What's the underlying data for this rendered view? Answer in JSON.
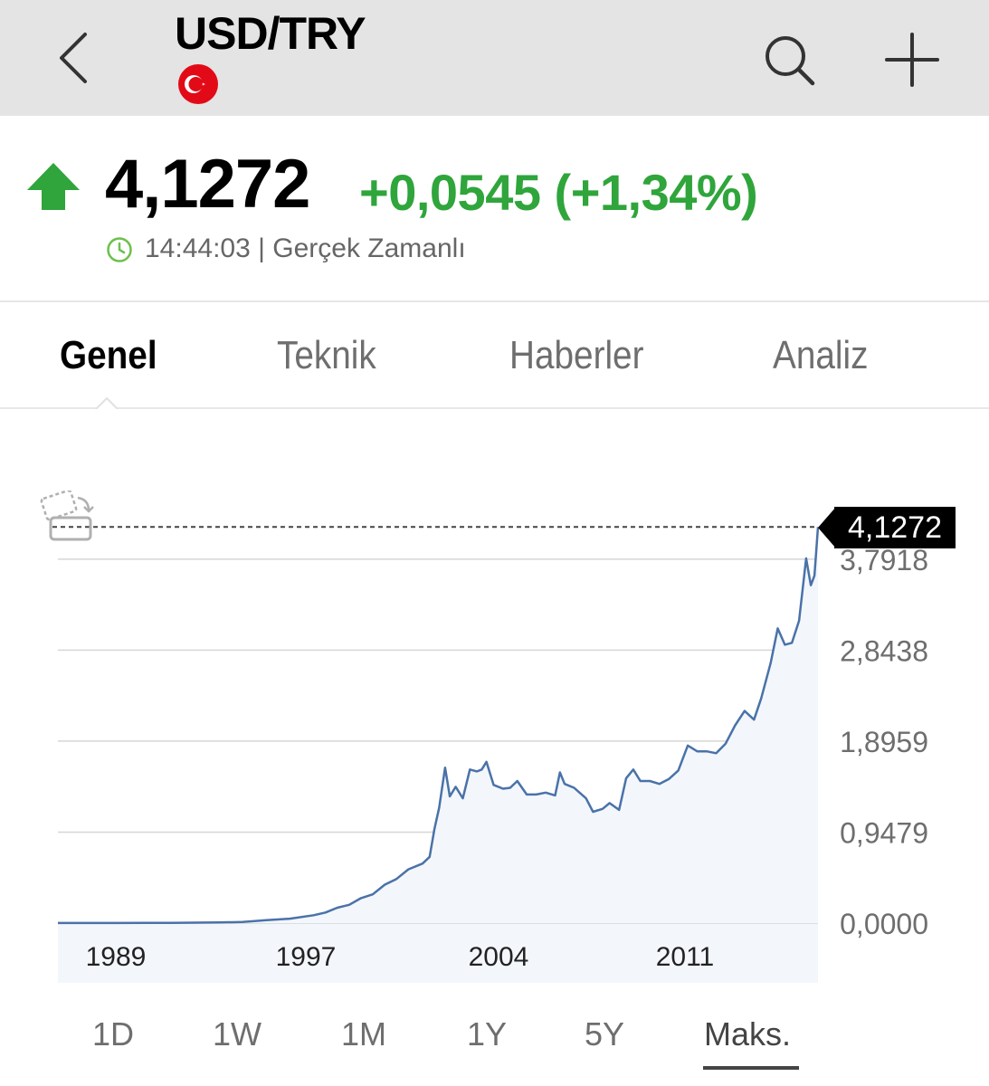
{
  "header": {
    "title": "USD/TRY",
    "flag_icon": "turkey-flag-icon",
    "back_icon": "chevron-left-icon",
    "search_icon": "search-icon",
    "add_icon": "plus-icon"
  },
  "quote": {
    "direction_icon": "arrow-up-icon",
    "price": "4,1272",
    "change": "+0,0545 (+1,34%)",
    "time": "14:44:03",
    "status": "| Gerçek Zamanlı",
    "change_color": "#2fa53b"
  },
  "tabs": [
    {
      "label": "Genel",
      "active": true
    },
    {
      "label": "Teknik",
      "active": false
    },
    {
      "label": "Haberler",
      "active": false
    },
    {
      "label": "Analiz",
      "active": false
    }
  ],
  "chart_data": {
    "type": "area",
    "current_value": 4.1272,
    "current_label": "4,1272",
    "y_ticks": [
      {
        "value": 0.0,
        "label": "0,0000"
      },
      {
        "value": 0.9479,
        "label": "0,9479"
      },
      {
        "value": 1.8959,
        "label": "1,8959"
      },
      {
        "value": 2.8438,
        "label": "2,8438"
      },
      {
        "value": 3.7918,
        "label": "3,7918"
      }
    ],
    "x_ticks": [
      "1989",
      "1997",
      "2004",
      "2011"
    ],
    "xlim": [
      1985.2,
      2017.3
    ],
    "ylim": [
      0.0,
      4.13
    ],
    "line_color": "#4a72a8",
    "fill_color": "#f3f7fc",
    "points": [
      [
        1985.2,
        0.0005
      ],
      [
        1987.0,
        0.0009
      ],
      [
        1989.0,
        0.0021
      ],
      [
        1990.0,
        0.0029
      ],
      [
        1991.0,
        0.0044
      ],
      [
        1992.0,
        0.0069
      ],
      [
        1993.0,
        0.011
      ],
      [
        1994.0,
        0.03
      ],
      [
        1995.0,
        0.046
      ],
      [
        1996.0,
        0.082
      ],
      [
        1996.5,
        0.11
      ],
      [
        1997.0,
        0.16
      ],
      [
        1997.5,
        0.19
      ],
      [
        1998.0,
        0.26
      ],
      [
        1998.5,
        0.3
      ],
      [
        1999.0,
        0.4
      ],
      [
        1999.5,
        0.46
      ],
      [
        2000.0,
        0.56
      ],
      [
        2000.6,
        0.62
      ],
      [
        2000.9,
        0.69
      ],
      [
        2001.1,
        0.98
      ],
      [
        2001.3,
        1.2
      ],
      [
        2001.55,
        1.62
      ],
      [
        2001.75,
        1.32
      ],
      [
        2002.0,
        1.42
      ],
      [
        2002.3,
        1.3
      ],
      [
        2002.6,
        1.6
      ],
      [
        2002.9,
        1.58
      ],
      [
        2003.1,
        1.6
      ],
      [
        2003.3,
        1.68
      ],
      [
        2003.6,
        1.44
      ],
      [
        2004.0,
        1.4
      ],
      [
        2004.3,
        1.41
      ],
      [
        2004.6,
        1.48
      ],
      [
        2005.0,
        1.34
      ],
      [
        2005.4,
        1.34
      ],
      [
        2005.8,
        1.36
      ],
      [
        2006.2,
        1.33
      ],
      [
        2006.4,
        1.57
      ],
      [
        2006.6,
        1.45
      ],
      [
        2007.0,
        1.41
      ],
      [
        2007.5,
        1.3
      ],
      [
        2007.8,
        1.16
      ],
      [
        2008.2,
        1.19
      ],
      [
        2008.5,
        1.25
      ],
      [
        2008.9,
        1.18
      ],
      [
        2009.2,
        1.51
      ],
      [
        2009.5,
        1.6
      ],
      [
        2009.8,
        1.48
      ],
      [
        2010.2,
        1.48
      ],
      [
        2010.6,
        1.45
      ],
      [
        2011.0,
        1.5
      ],
      [
        2011.4,
        1.59
      ],
      [
        2011.8,
        1.85
      ],
      [
        2012.2,
        1.79
      ],
      [
        2012.6,
        1.79
      ],
      [
        2013.0,
        1.77
      ],
      [
        2013.4,
        1.87
      ],
      [
        2013.8,
        2.06
      ],
      [
        2014.2,
        2.21
      ],
      [
        2014.6,
        2.12
      ],
      [
        2014.9,
        2.34
      ],
      [
        2015.3,
        2.71
      ],
      [
        2015.6,
        3.07
      ],
      [
        2015.9,
        2.9
      ],
      [
        2016.2,
        2.92
      ],
      [
        2016.5,
        3.15
      ],
      [
        2016.8,
        3.8
      ],
      [
        2017.0,
        3.52
      ],
      [
        2017.15,
        3.62
      ],
      [
        2017.3,
        4.1272
      ]
    ]
  },
  "ranges": [
    {
      "label": "1D",
      "active": false
    },
    {
      "label": "1W",
      "active": false
    },
    {
      "label": "1M",
      "active": false
    },
    {
      "label": "1Y",
      "active": false
    },
    {
      "label": "5Y",
      "active": false
    },
    {
      "label": "Maks.",
      "active": true
    }
  ]
}
